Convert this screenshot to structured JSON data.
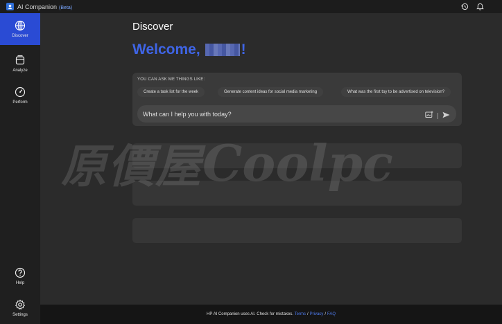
{
  "app": {
    "title": "AI Companion",
    "beta": "(Beta)",
    "icons": [
      "history-icon",
      "bell-icon"
    ]
  },
  "sidebar": {
    "items": [
      {
        "label": "Discover",
        "icon": "globe-icon",
        "active": true
      },
      {
        "label": "Analyze",
        "icon": "documents-icon",
        "active": false
      },
      {
        "label": "Perform",
        "icon": "gauge-icon",
        "active": false
      }
    ],
    "bottom": [
      {
        "label": "Help",
        "icon": "help-icon"
      },
      {
        "label": "Settings",
        "icon": "gear-icon"
      }
    ]
  },
  "main": {
    "page_title": "Discover",
    "welcome_prefix": "Welcome,",
    "welcome_suffix": "!",
    "ask_heading": "YOU CAN ASK ME THINGS LIKE:",
    "suggestions": [
      "Create a task list for the week",
      "Generate content ideas for social media marketing",
      "What was the first toy to be advertised on television?"
    ],
    "chat_placeholder": "What can I help you with today?"
  },
  "watermark": {
    "cjk": "原價屋",
    "latin": "Coolpc"
  },
  "footer": {
    "text": "HP AI Companion uses AI. Check for mistakes.",
    "links": [
      "Terms",
      "Privacy",
      "FAQ"
    ],
    "separator": "/"
  },
  "colors": {
    "accent": "#2a4bd4",
    "welcome": "#3f65e6",
    "link": "#4f7df2"
  }
}
